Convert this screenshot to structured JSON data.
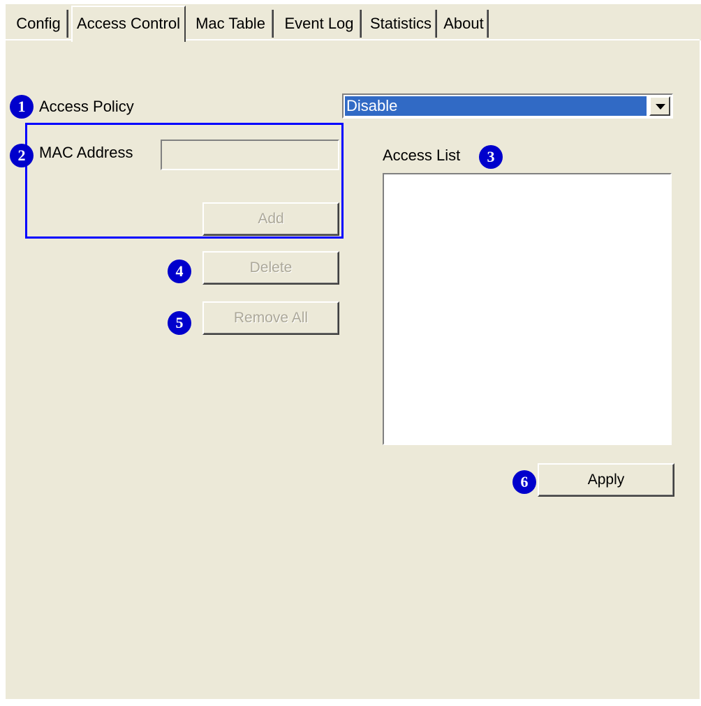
{
  "tabs": [
    {
      "label": "Config",
      "active": false
    },
    {
      "label": "Access Control",
      "active": true
    },
    {
      "label": "Mac Table",
      "active": false
    },
    {
      "label": "Event Log",
      "active": false
    },
    {
      "label": "Statistics",
      "active": false
    },
    {
      "label": "About",
      "active": false
    }
  ],
  "callouts": [
    "1",
    "2",
    "3",
    "4",
    "5",
    "6"
  ],
  "access_policy": {
    "label": "Access Policy",
    "selected": "Disable"
  },
  "mac_address": {
    "label": "MAC Address",
    "value": "",
    "add_label": "Add"
  },
  "access_list": {
    "label": "Access List",
    "items": []
  },
  "buttons": {
    "delete_label": "Delete",
    "remove_all_label": "Remove All",
    "apply_label": "Apply"
  },
  "colors": {
    "panel_bg": "#ece9d8",
    "selection_bg": "#316ac5",
    "callout_bg": "#0000cc",
    "group_highlight": "#0000ff"
  }
}
